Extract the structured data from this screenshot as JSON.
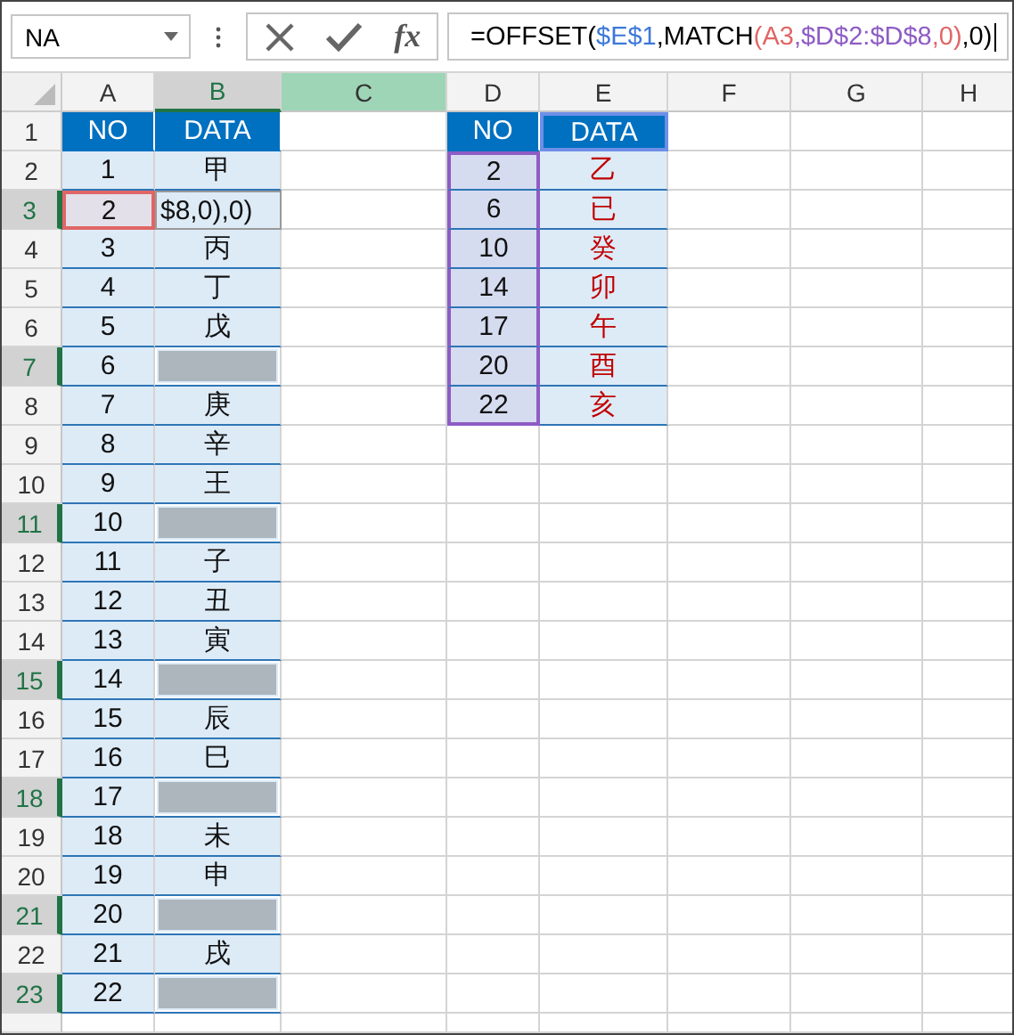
{
  "name_box": {
    "value": "NA"
  },
  "formula_bar": {
    "fx": "fx",
    "formula": [
      {
        "text": "=OFFSET(",
        "color": "#000000"
      },
      {
        "text": "$E$1",
        "color": "#3c78d8"
      },
      {
        "text": ",MATCH",
        "color": "#000000"
      },
      {
        "text": "(A3",
        "color": "#e06666"
      },
      {
        "text": ",$D$2:$D$8",
        "color": "#8e5cc4"
      },
      {
        "text": ",0)",
        "color": "#e06666"
      },
      {
        "text": ",0)",
        "color": "#000000"
      }
    ]
  },
  "columns": [
    {
      "label": "A",
      "selected": false,
      "hovered": false
    },
    {
      "label": "B",
      "selected": true,
      "hovered": false
    },
    {
      "label": "C",
      "selected": false,
      "hovered": true
    },
    {
      "label": "D",
      "selected": false,
      "hovered": false
    },
    {
      "label": "E",
      "selected": false,
      "hovered": false
    },
    {
      "label": "F",
      "selected": false,
      "hovered": false
    },
    {
      "label": "G",
      "selected": false,
      "hovered": false
    },
    {
      "label": "H",
      "selected": false,
      "hovered": false
    }
  ],
  "row_headers": [
    {
      "label": "1",
      "selected": false
    },
    {
      "label": "2",
      "selected": false
    },
    {
      "label": "3",
      "selected": true
    },
    {
      "label": "4",
      "selected": false
    },
    {
      "label": "5",
      "selected": false
    },
    {
      "label": "6",
      "selected": false
    },
    {
      "label": "7",
      "selected": true
    },
    {
      "label": "8",
      "selected": false
    },
    {
      "label": "9",
      "selected": false
    },
    {
      "label": "10",
      "selected": false
    },
    {
      "label": "11",
      "selected": true
    },
    {
      "label": "12",
      "selected": false
    },
    {
      "label": "13",
      "selected": false
    },
    {
      "label": "14",
      "selected": false
    },
    {
      "label": "15",
      "selected": true
    },
    {
      "label": "16",
      "selected": false
    },
    {
      "label": "17",
      "selected": false
    },
    {
      "label": "18",
      "selected": true
    },
    {
      "label": "19",
      "selected": false
    },
    {
      "label": "20",
      "selected": false
    },
    {
      "label": "21",
      "selected": true
    },
    {
      "label": "22",
      "selected": false
    },
    {
      "label": "23",
      "selected": true
    }
  ],
  "left_table": {
    "header": [
      {
        "text": "NO",
        "referenced": false
      },
      {
        "text": "DATA",
        "referenced": false
      }
    ],
    "rows": [
      {
        "no": "1",
        "data": "甲",
        "kind": "value",
        "referenced": false
      },
      {
        "no": "2",
        "data": "$8,0),0)",
        "kind": "editing",
        "referenced": true
      },
      {
        "no": "3",
        "data": "丙",
        "kind": "value",
        "referenced": false
      },
      {
        "no": "4",
        "data": "丁",
        "kind": "value",
        "referenced": false
      },
      {
        "no": "5",
        "data": "戊",
        "kind": "value",
        "referenced": false
      },
      {
        "no": "6",
        "kind": "blank",
        "referenced": false
      },
      {
        "no": "7",
        "data": "庚",
        "kind": "value",
        "referenced": false
      },
      {
        "no": "8",
        "data": "辛",
        "kind": "value",
        "referenced": false
      },
      {
        "no": "9",
        "data": "王",
        "kind": "value",
        "referenced": false
      },
      {
        "no": "10",
        "kind": "blank",
        "referenced": false
      },
      {
        "no": "11",
        "data": "子",
        "kind": "value",
        "referenced": false
      },
      {
        "no": "12",
        "data": "丑",
        "kind": "value",
        "referenced": false
      },
      {
        "no": "13",
        "data": "寅",
        "kind": "value",
        "referenced": false
      },
      {
        "no": "14",
        "kind": "blank",
        "referenced": false
      },
      {
        "no": "15",
        "data": "辰",
        "kind": "value",
        "referenced": false
      },
      {
        "no": "16",
        "data": "巳",
        "kind": "value",
        "referenced": false
      },
      {
        "no": "17",
        "kind": "blank",
        "referenced": false
      },
      {
        "no": "18",
        "data": "未",
        "kind": "value",
        "referenced": false
      },
      {
        "no": "19",
        "data": "申",
        "kind": "value",
        "referenced": false
      },
      {
        "no": "20",
        "kind": "blank",
        "referenced": false
      },
      {
        "no": "21",
        "data": "戌",
        "kind": "value",
        "referenced": false
      },
      {
        "no": "22",
        "kind": "blank",
        "referenced": false
      }
    ]
  },
  "right_table": {
    "header": [
      {
        "text": "NO",
        "referenced": false
      },
      {
        "text": "DATA",
        "referenced": true
      }
    ],
    "rows": [
      {
        "no": "2",
        "data": "乙",
        "referenced": true
      },
      {
        "no": "6",
        "data": "已",
        "referenced": true
      },
      {
        "no": "10",
        "data": "癸",
        "referenced": true
      },
      {
        "no": "14",
        "data": "卯",
        "referenced": true
      },
      {
        "no": "17",
        "data": "午",
        "referenced": true
      },
      {
        "no": "20",
        "data": "酉",
        "referenced": true
      },
      {
        "no": "22",
        "data": "亥",
        "referenced": true
      }
    ]
  }
}
